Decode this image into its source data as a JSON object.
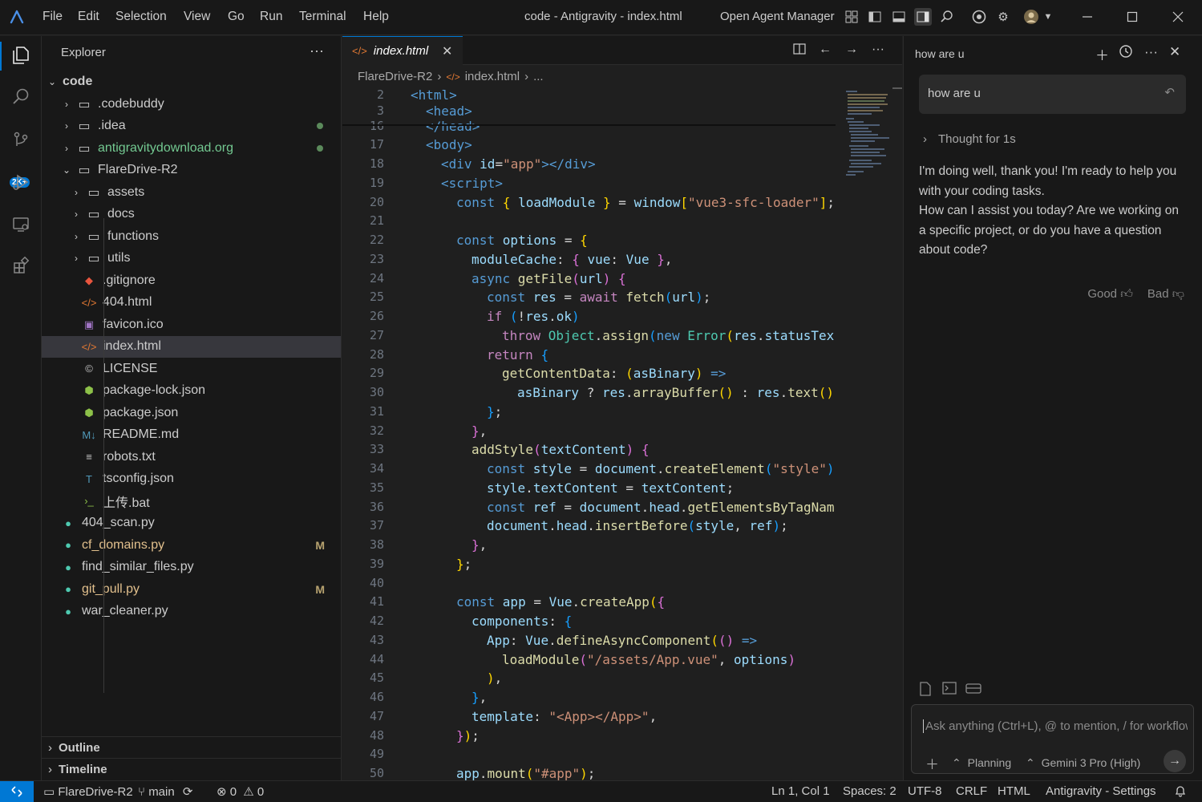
{
  "titlebar": {
    "menu": [
      "File",
      "Edit",
      "Selection",
      "View",
      "Go",
      "Run",
      "Terminal",
      "Help"
    ],
    "window_title": "code - Antigravity - index.html",
    "agent_manager": "Open Agent Manager"
  },
  "sidebar": {
    "title": "Explorer",
    "root": "code",
    "items": [
      {
        "label": ".codebuddy",
        "kind": "folder",
        "icon": "folder-icon"
      },
      {
        "label": ".idea",
        "kind": "folder",
        "icon": "folder-icon"
      },
      {
        "label": "antigravitydownload.org",
        "kind": "folder",
        "icon": "folder-icon"
      },
      {
        "label": "FlareDrive-R2",
        "kind": "folder-open",
        "icon": "folder-icon"
      },
      {
        "label": "assets",
        "kind": "folder",
        "icon": "folder-assets-icon"
      },
      {
        "label": "docs",
        "kind": "folder",
        "icon": "folder-docs-icon"
      },
      {
        "label": "functions",
        "kind": "folder",
        "icon": "folder-icon"
      },
      {
        "label": "utils",
        "kind": "folder",
        "icon": "folder-utils-icon"
      },
      {
        "label": ".gitignore",
        "kind": "file",
        "icon": "git-icon"
      },
      {
        "label": "404.html",
        "kind": "file",
        "icon": "html-icon"
      },
      {
        "label": "favicon.ico",
        "kind": "file",
        "icon": "image-icon"
      },
      {
        "label": "index.html",
        "kind": "file",
        "icon": "html-icon"
      },
      {
        "label": "LICENSE",
        "kind": "file",
        "icon": "license-icon"
      },
      {
        "label": "package-lock.json",
        "kind": "file",
        "icon": "npm-icon"
      },
      {
        "label": "package.json",
        "kind": "file",
        "icon": "npm-icon"
      },
      {
        "label": "README.md",
        "kind": "file",
        "icon": "markdown-icon"
      },
      {
        "label": "robots.txt",
        "kind": "file",
        "icon": "text-icon"
      },
      {
        "label": "tsconfig.json",
        "kind": "file",
        "icon": "tsconfig-icon"
      },
      {
        "label": "上传.bat",
        "kind": "file",
        "icon": "terminal-icon"
      },
      {
        "label": "404_scan.py",
        "kind": "file",
        "icon": "python-icon"
      },
      {
        "label": "cf_domains.py",
        "kind": "file",
        "icon": "python-icon",
        "status": "M"
      },
      {
        "label": "find_similar_files.py",
        "kind": "file",
        "icon": "python-icon"
      },
      {
        "label": "git_pull.py",
        "kind": "file",
        "icon": "python-icon",
        "status": "M"
      },
      {
        "label": "war_cleaner.py",
        "kind": "file",
        "icon": "python-icon"
      }
    ],
    "outline": "Outline",
    "timeline": "Timeline"
  },
  "editor": {
    "tab_label": "index.html",
    "breadcrumb": [
      "FlareDrive-R2",
      "index.html",
      "..."
    ],
    "lines": [
      {
        "n": "2",
        "indent": 0,
        "t": [
          [
            "tk-tag",
            "<html>"
          ]
        ]
      },
      {
        "n": "3",
        "indent": 1,
        "t": [
          [
            "tk-tag",
            "<head>"
          ]
        ]
      },
      {
        "n": "16",
        "indent": 1,
        "t": [
          [
            "tk-tag",
            "</head>"
          ]
        ]
      },
      {
        "n": "17",
        "indent": 1,
        "t": [
          [
            "tk-tag",
            "<body>"
          ]
        ]
      },
      {
        "n": "18",
        "indent": 2,
        "t": [
          [
            "tk-tag",
            "<div "
          ],
          [
            "tk-attr",
            "id"
          ],
          [
            "tk-pun",
            "="
          ],
          [
            "tk-str",
            "\"app\""
          ],
          [
            "tk-tag",
            "></div>"
          ]
        ]
      },
      {
        "n": "19",
        "indent": 2,
        "t": [
          [
            "tk-tag",
            "<script>"
          ]
        ]
      },
      {
        "n": "20",
        "indent": 3,
        "t": [
          [
            "tk-kw",
            "const "
          ],
          [
            "tk-b1",
            "{ "
          ],
          [
            "tk-var",
            "loadModule"
          ],
          [
            "tk-b1",
            " }"
          ],
          [
            "tk-pun",
            " = "
          ],
          [
            "tk-var",
            "window"
          ],
          [
            "tk-b1",
            "["
          ],
          [
            "tk-str",
            "\"vue3-sfc-loader\""
          ],
          [
            "tk-b1",
            "]"
          ],
          [
            "tk-pun",
            ";"
          ]
        ]
      },
      {
        "n": "21",
        "indent": 0,
        "t": []
      },
      {
        "n": "22",
        "indent": 3,
        "t": [
          [
            "tk-kw",
            "const "
          ],
          [
            "tk-var",
            "options"
          ],
          [
            "tk-pun",
            " = "
          ],
          [
            "tk-b1",
            "{"
          ]
        ]
      },
      {
        "n": "23",
        "indent": 4,
        "t": [
          [
            "tk-var",
            "moduleCache"
          ],
          [
            "tk-pun",
            ": "
          ],
          [
            "tk-b2",
            "{ "
          ],
          [
            "tk-var",
            "vue"
          ],
          [
            "tk-pun",
            ": "
          ],
          [
            "tk-var",
            "Vue"
          ],
          [
            "tk-b2",
            " }"
          ],
          [
            "tk-pun",
            ","
          ]
        ]
      },
      {
        "n": "24",
        "indent": 4,
        "t": [
          [
            "tk-kw",
            "async "
          ],
          [
            "tk-fn",
            "getFile"
          ],
          [
            "tk-b2",
            "("
          ],
          [
            "tk-var",
            "url"
          ],
          [
            "tk-b2",
            ") {"
          ]
        ]
      },
      {
        "n": "25",
        "indent": 5,
        "t": [
          [
            "tk-kw",
            "const "
          ],
          [
            "tk-var",
            "res"
          ],
          [
            "tk-pun",
            " = "
          ],
          [
            "tk-ctrl",
            "await "
          ],
          [
            "tk-fn",
            "fetch"
          ],
          [
            "tk-b3",
            "("
          ],
          [
            "tk-var",
            "url"
          ],
          [
            "tk-b3",
            ")"
          ],
          [
            "tk-pun",
            ";"
          ]
        ]
      },
      {
        "n": "26",
        "indent": 5,
        "t": [
          [
            "tk-ctrl",
            "if "
          ],
          [
            "tk-b3",
            "("
          ],
          [
            "tk-pun",
            "!"
          ],
          [
            "tk-var",
            "res"
          ],
          [
            "tk-pun",
            "."
          ],
          [
            "tk-var",
            "ok"
          ],
          [
            "tk-b3",
            ")"
          ]
        ]
      },
      {
        "n": "27",
        "indent": 6,
        "t": [
          [
            "tk-ctrl",
            "throw "
          ],
          [
            "tk-cls",
            "Object"
          ],
          [
            "tk-pun",
            "."
          ],
          [
            "tk-fn",
            "assign"
          ],
          [
            "tk-b3",
            "("
          ],
          [
            "tk-kw",
            "new "
          ],
          [
            "tk-cls",
            "Error"
          ],
          [
            "tk-b1",
            "("
          ],
          [
            "tk-var",
            "res"
          ],
          [
            "tk-pun",
            "."
          ],
          [
            "tk-var",
            "statusTex"
          ]
        ]
      },
      {
        "n": "28",
        "indent": 5,
        "t": [
          [
            "tk-ctrl",
            "return "
          ],
          [
            "tk-b3",
            "{"
          ]
        ]
      },
      {
        "n": "29",
        "indent": 6,
        "t": [
          [
            "tk-fn",
            "getContentData"
          ],
          [
            "tk-pun",
            ": "
          ],
          [
            "tk-b1",
            "("
          ],
          [
            "tk-var",
            "asBinary"
          ],
          [
            "tk-b1",
            ")"
          ],
          [
            "tk-kw",
            " =>"
          ]
        ]
      },
      {
        "n": "30",
        "indent": 7,
        "t": [
          [
            "tk-var",
            "asBinary"
          ],
          [
            "tk-pun",
            " ? "
          ],
          [
            "tk-var",
            "res"
          ],
          [
            "tk-pun",
            "."
          ],
          [
            "tk-fn",
            "arrayBuffer"
          ],
          [
            "tk-b1",
            "()"
          ],
          [
            "tk-pun",
            " : "
          ],
          [
            "tk-var",
            "res"
          ],
          [
            "tk-pun",
            "."
          ],
          [
            "tk-fn",
            "text"
          ],
          [
            "tk-b1",
            "()"
          ]
        ]
      },
      {
        "n": "31",
        "indent": 5,
        "t": [
          [
            "tk-b3",
            "}"
          ],
          [
            "tk-pun",
            ";"
          ]
        ]
      },
      {
        "n": "32",
        "indent": 4,
        "t": [
          [
            "tk-b2",
            "}"
          ],
          [
            "tk-pun",
            ","
          ]
        ]
      },
      {
        "n": "33",
        "indent": 4,
        "t": [
          [
            "tk-fn",
            "addStyle"
          ],
          [
            "tk-b2",
            "("
          ],
          [
            "tk-var",
            "textContent"
          ],
          [
            "tk-b2",
            ") {"
          ]
        ]
      },
      {
        "n": "34",
        "indent": 5,
        "t": [
          [
            "tk-kw",
            "const "
          ],
          [
            "tk-var",
            "style"
          ],
          [
            "tk-pun",
            " = "
          ],
          [
            "tk-var",
            "document"
          ],
          [
            "tk-pun",
            "."
          ],
          [
            "tk-fn",
            "createElement"
          ],
          [
            "tk-b3",
            "("
          ],
          [
            "tk-str",
            "\"style\""
          ],
          [
            "tk-b3",
            ")"
          ]
        ]
      },
      {
        "n": "35",
        "indent": 5,
        "t": [
          [
            "tk-var",
            "style"
          ],
          [
            "tk-pun",
            "."
          ],
          [
            "tk-var",
            "textContent"
          ],
          [
            "tk-pun",
            " = "
          ],
          [
            "tk-var",
            "textContent"
          ],
          [
            "tk-pun",
            ";"
          ]
        ]
      },
      {
        "n": "36",
        "indent": 5,
        "t": [
          [
            "tk-kw",
            "const "
          ],
          [
            "tk-var",
            "ref"
          ],
          [
            "tk-pun",
            " = "
          ],
          [
            "tk-var",
            "document"
          ],
          [
            "tk-pun",
            "."
          ],
          [
            "tk-var",
            "head"
          ],
          [
            "tk-pun",
            "."
          ],
          [
            "tk-fn",
            "getElementsByTagNam"
          ]
        ]
      },
      {
        "n": "37",
        "indent": 5,
        "t": [
          [
            "tk-var",
            "document"
          ],
          [
            "tk-pun",
            "."
          ],
          [
            "tk-var",
            "head"
          ],
          [
            "tk-pun",
            "."
          ],
          [
            "tk-fn",
            "insertBefore"
          ],
          [
            "tk-b3",
            "("
          ],
          [
            "tk-var",
            "style"
          ],
          [
            "tk-pun",
            ", "
          ],
          [
            "tk-var",
            "ref"
          ],
          [
            "tk-b3",
            ")"
          ],
          [
            "tk-pun",
            ";"
          ]
        ]
      },
      {
        "n": "38",
        "indent": 4,
        "t": [
          [
            "tk-b2",
            "}"
          ],
          [
            "tk-pun",
            ","
          ]
        ]
      },
      {
        "n": "39",
        "indent": 3,
        "t": [
          [
            "tk-b1",
            "}"
          ],
          [
            "tk-pun",
            ";"
          ]
        ]
      },
      {
        "n": "40",
        "indent": 0,
        "t": []
      },
      {
        "n": "41",
        "indent": 3,
        "t": [
          [
            "tk-kw",
            "const "
          ],
          [
            "tk-var",
            "app"
          ],
          [
            "tk-pun",
            " = "
          ],
          [
            "tk-var",
            "Vue"
          ],
          [
            "tk-pun",
            "."
          ],
          [
            "tk-fn",
            "createApp"
          ],
          [
            "tk-b1",
            "("
          ],
          [
            "tk-b2",
            "{"
          ]
        ]
      },
      {
        "n": "42",
        "indent": 4,
        "t": [
          [
            "tk-var",
            "components"
          ],
          [
            "tk-pun",
            ": "
          ],
          [
            "tk-b3",
            "{"
          ]
        ]
      },
      {
        "n": "43",
        "indent": 5,
        "t": [
          [
            "tk-var",
            "App"
          ],
          [
            "tk-pun",
            ": "
          ],
          [
            "tk-var",
            "Vue"
          ],
          [
            "tk-pun",
            "."
          ],
          [
            "tk-fn",
            "defineAsyncComponent"
          ],
          [
            "tk-b1",
            "("
          ],
          [
            "tk-b2",
            "()"
          ],
          [
            "tk-kw",
            " =>"
          ]
        ]
      },
      {
        "n": "44",
        "indent": 6,
        "t": [
          [
            "tk-fn",
            "loadModule"
          ],
          [
            "tk-b2",
            "("
          ],
          [
            "tk-str",
            "\"/assets/App.vue\""
          ],
          [
            "tk-pun",
            ", "
          ],
          [
            "tk-var",
            "options"
          ],
          [
            "tk-b2",
            ")"
          ]
        ]
      },
      {
        "n": "45",
        "indent": 5,
        "t": [
          [
            "tk-b1",
            ")"
          ],
          [
            "tk-pun",
            ","
          ]
        ]
      },
      {
        "n": "46",
        "indent": 4,
        "t": [
          [
            "tk-b3",
            "}"
          ],
          [
            "tk-pun",
            ","
          ]
        ]
      },
      {
        "n": "47",
        "indent": 4,
        "t": [
          [
            "tk-var",
            "template"
          ],
          [
            "tk-pun",
            ": "
          ],
          [
            "tk-str",
            "\"<App></App>\""
          ],
          [
            "tk-pun",
            ","
          ]
        ]
      },
      {
        "n": "48",
        "indent": 3,
        "t": [
          [
            "tk-b2",
            "}"
          ],
          [
            "tk-b1",
            ")"
          ],
          [
            "tk-pun",
            ";"
          ]
        ]
      },
      {
        "n": "49",
        "indent": 0,
        "t": []
      },
      {
        "n": "50",
        "indent": 3,
        "t": [
          [
            "tk-var",
            "app"
          ],
          [
            "tk-pun",
            "."
          ],
          [
            "tk-fn",
            "mount"
          ],
          [
            "tk-b1",
            "("
          ],
          [
            "tk-str",
            "\"#app\""
          ],
          [
            "tk-b1",
            ")"
          ],
          [
            "tk-pun",
            ";"
          ]
        ]
      }
    ]
  },
  "chat": {
    "title": "how are u",
    "user_message": "how are u",
    "thought": "Thought for 1s",
    "reply": [
      "I'm doing well, thank you! I'm ready to help you with your coding tasks.",
      "How can I assist you today? Are we working on a specific project, or do you have a question about code?"
    ],
    "feedback_good": "Good",
    "feedback_bad": "Bad",
    "input_placeholder": "Ask anything (Ctrl+L), @ to mention, / for workflows",
    "mode": "Planning",
    "model": "Gemini 3 Pro (High)"
  },
  "statusbar": {
    "project": "FlareDrive-R2",
    "branch": "main",
    "errors": "0",
    "warnings": "0",
    "cursor": "Ln 1, Col 1",
    "spaces": "Spaces: 2",
    "encoding": "UTF-8",
    "eol": "CRLF",
    "language": "HTML",
    "settings": "Antigravity - Settings"
  },
  "colors": {
    "accent": "#0078d4",
    "modified": "#e2c08d",
    "untracked": "#73c991"
  }
}
